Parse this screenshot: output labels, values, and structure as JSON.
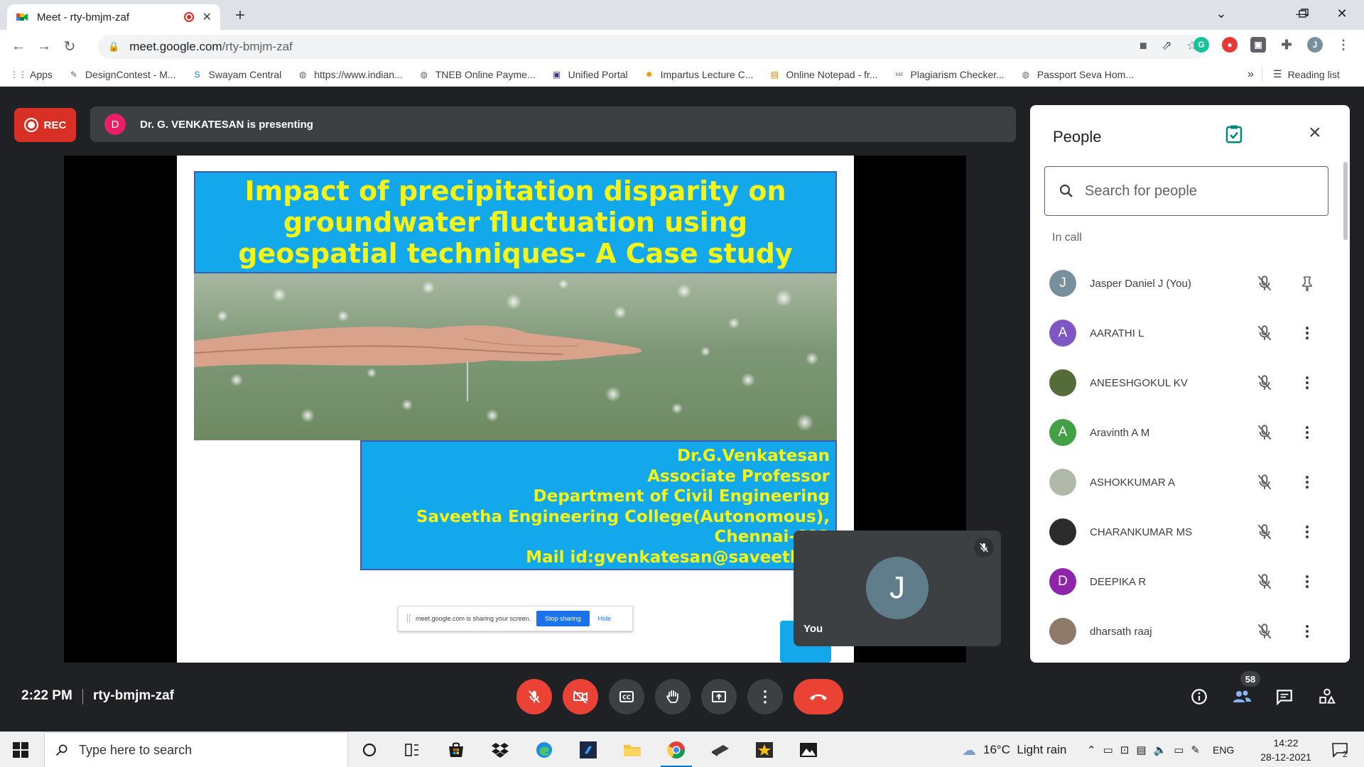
{
  "browser": {
    "tab_title": "Meet - rty-bmjm-zaf",
    "url_host": "meet.google.com",
    "url_path": "/rty-bmjm-zaf",
    "profile_initial": "J",
    "bookmarks": [
      {
        "label": "Apps",
        "icon": "apps-grid-icon"
      },
      {
        "label": "DesignContest - M...",
        "icon": "design-contest-icon"
      },
      {
        "label": "Swayam Central",
        "icon": "swayam-icon"
      },
      {
        "label": "https://www.indian...",
        "icon": "globe-icon"
      },
      {
        "label": "TNEB Online Payme...",
        "icon": "globe-icon"
      },
      {
        "label": "Unified Portal",
        "icon": "rec-portal-icon"
      },
      {
        "label": "Impartus Lecture C...",
        "icon": "impartus-icon"
      },
      {
        "label": "Online Notepad - fr...",
        "icon": "notepad-icon"
      },
      {
        "label": "Plagiarism Checker...",
        "icon": "sst-icon"
      },
      {
        "label": "Passport Seva Hom...",
        "icon": "globe-icon"
      }
    ],
    "bookmarks_more": "»",
    "reading_list": "Reading list"
  },
  "meet": {
    "rec_label": "REC",
    "presenter_initial": "D",
    "presenting_text": "Dr. G. VENKATESAN is presenting",
    "slide": {
      "title": "Impact of precipitation disparity on groundwater fluctuation using geospatial techniques- A Case study",
      "info_lines": [
        "Dr.G.Venkatesan",
        "Associate Professor",
        "Department of Civil Engineering",
        "Saveetha Engineering College(Autonomous),",
        "Chennai-602",
        "Mail id:gvenkatesan@saveetha.a"
      ],
      "share_text": "meet.google.com is sharing your screen.",
      "share_stop": "Stop sharing",
      "share_hide": "Hide"
    },
    "self_tile": {
      "initial": "J",
      "name": "You"
    },
    "time": "2:22 PM",
    "meeting_code": "rty-bmjm-zaf",
    "participants_count": "58",
    "colors": {
      "end_call": "#ea4335",
      "mute_active": "#ea4335",
      "control_grey": "#3c4043",
      "panel_bg": "#ffffff"
    }
  },
  "people": {
    "title": "People",
    "search_placeholder": "Search for people",
    "section": "In call",
    "participants": [
      {
        "name": "Jasper Daniel J (You)",
        "initial": "J",
        "color": "#78909c",
        "pinned_icon": true
      },
      {
        "name": "AARATHI L",
        "initial": "A",
        "color": "#7e57c2"
      },
      {
        "name": "ANEESHGOKUL KV",
        "initial": "",
        "color": "#556b3a"
      },
      {
        "name": "Aravinth A M",
        "initial": "A",
        "color": "#43a047"
      },
      {
        "name": "ASHOKKUMAR A",
        "initial": "",
        "color": "#b0b8a8"
      },
      {
        "name": "CHARANKUMAR MS",
        "initial": "",
        "color": "#2b2b2b"
      },
      {
        "name": "DEEPIKA R",
        "initial": "D",
        "color": "#8e24aa"
      },
      {
        "name": "dharsath raaj",
        "initial": "",
        "color": "#8d7a6a"
      }
    ]
  },
  "taskbar": {
    "search_placeholder": "Type here to search",
    "weather": "16°C  Light rain",
    "language": "ENG",
    "time": "14:22",
    "date": "28-12-2021",
    "notifications": "2"
  }
}
